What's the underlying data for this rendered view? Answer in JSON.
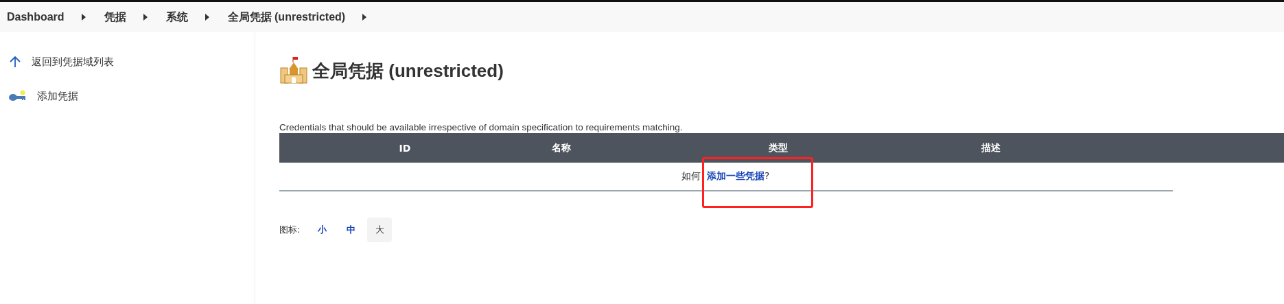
{
  "breadcrumbs": [
    "Dashboard",
    "凭据",
    "系统",
    "全局凭据 (unrestricted)"
  ],
  "sidebar": {
    "items": [
      {
        "kind": "up",
        "label": "返回到凭据域列表"
      },
      {
        "kind": "key",
        "label": "添加凭据"
      }
    ]
  },
  "heading": "全局凭据 (unrestricted)",
  "description": "Credentials that should be available irrespective of domain specification to requirements matching.",
  "table": {
    "columns": [
      "ID",
      "名称",
      "类型",
      "描述"
    ],
    "empty_message": {
      "prefix": "如何",
      "link": "添加一些凭据",
      "suffix": "?"
    }
  },
  "icon_size": {
    "label": "图标:",
    "options": [
      {
        "label": "小",
        "selected": false
      },
      {
        "label": "中",
        "selected": false
      },
      {
        "label": "大",
        "selected": true
      }
    ]
  },
  "annotation": {
    "kind": "rectangle",
    "color": "#ff2020"
  }
}
